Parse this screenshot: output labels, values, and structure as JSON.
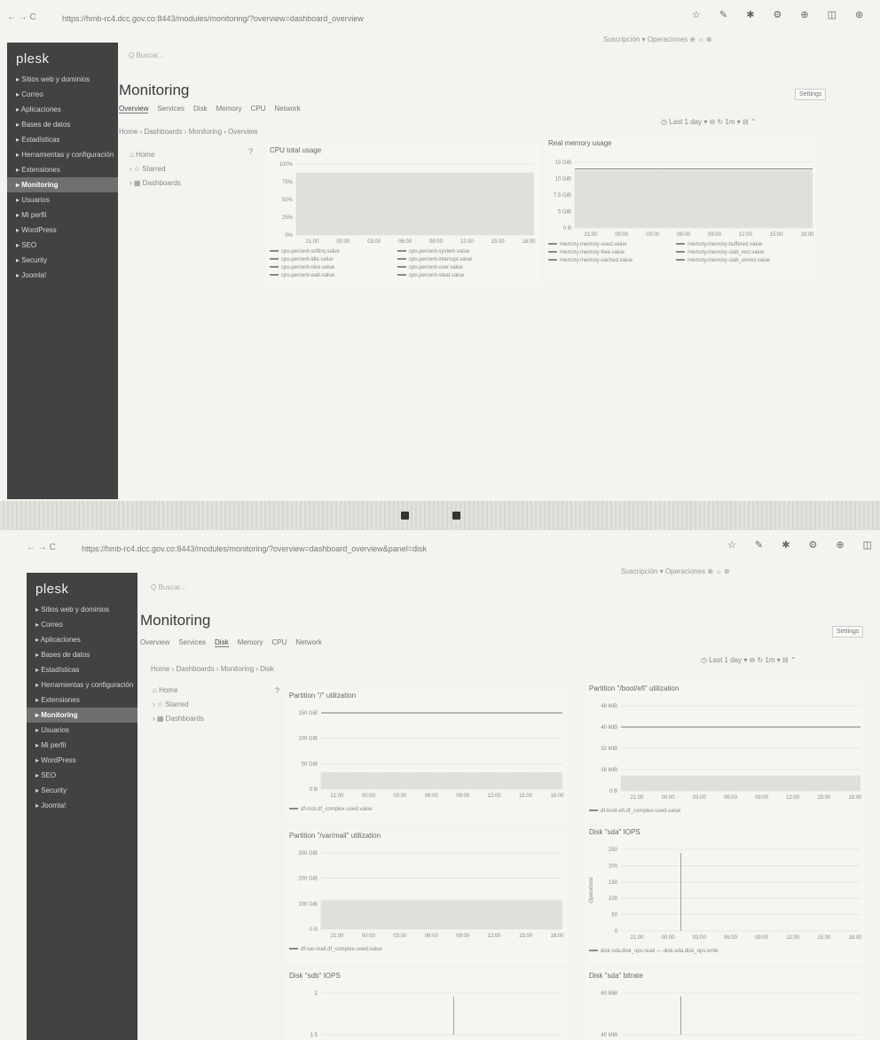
{
  "browser": {
    "nav": "←  →  C",
    "url1": "https://hmb-rc4.dcc.gov.co:8443/modules/monitoring/?overview=dashboard_overview",
    "url2": "https://hmb-rc4.dcc.gov.co:8443/modules/monitoring/?overview=dashboard_overview&panel=disk",
    "toolbar_icons": "☆ ✎ ✱ ⚙ ⊕ ◫  ⊛ ⋮",
    "subbar": "Suscripción ▾   Operaciones   ⊕  ☼  ⊗"
  },
  "sidebar": {
    "logo": "plesk",
    "items": [
      "Sitios web y dominios",
      "Correo",
      "Aplicaciones",
      "Bases de datos",
      "Estadísticas",
      "Herramientas y configuración",
      "Extensiones",
      "Monitoring",
      "Usuarios",
      "Mi perfil",
      "WordPress",
      "SEO",
      "Security",
      "Joomla!"
    ],
    "active_index": 7
  },
  "search_placeholder": "Q  Buscar...",
  "page": {
    "title": "Monitoring",
    "settings": "Settings",
    "tabs": [
      "Overview",
      "Services",
      "Disk",
      "Memory",
      "CPU",
      "Network"
    ],
    "toolbar": "◷ Last 1 day  ▾    ⊖    ↻    1m ▾    ⊟    ⌃"
  },
  "shot1": {
    "breadcrumb": "Home  ›  Dashboards  ›  Monitoring  ›  Overview",
    "tree": [
      "Home",
      "Starred",
      "Dashboards"
    ],
    "cpu_panel": {
      "title": "CPU total usage",
      "yticks": [
        "100%",
        "75%",
        "50%",
        "25%",
        "0%"
      ],
      "xticks": [
        "21:00",
        "00:00",
        "03:00",
        "06:00",
        "09:00",
        "12:00",
        "15:00",
        "18:00"
      ],
      "legend": [
        "cpu.percent-softirq.value",
        "cpu.percent-system.value",
        "cpu.percent-idle.value",
        "cpu.percent-interrupt.value",
        "cpu.percent-nice.value",
        "cpu.percent-user.value",
        "cpu.percent-wait.value",
        "cpu.percent-steal.value"
      ]
    },
    "mem_panel": {
      "title": "Real memory usage",
      "yticks": [
        "15 GiB",
        "10 GiB",
        "7.5 GiB",
        "5 GiB",
        "0 B"
      ],
      "xticks": [
        "21:00",
        "00:00",
        "03:00",
        "06:00",
        "09:00",
        "12:00",
        "15:00",
        "18:00"
      ],
      "legend": [
        "memory.memory-used.value",
        "memory.memory-buffered.value",
        "memory.memory-free.value",
        "memory.memory-slab_recl.value",
        "memory.memory-cached.value",
        "memory.memory-slab_unrecl.value"
      ]
    }
  },
  "shot2": {
    "breadcrumb": "Home  ›  Dashboards  ›  Monitoring  ›  Disk",
    "tree": [
      "Home",
      "Starred",
      "Dashboards"
    ],
    "panels": [
      {
        "title": "Partition \"/\" utilization",
        "yticks": [
          "150 GiB",
          "100 GiB",
          "50 GiB",
          "0 B"
        ],
        "legend": "df-root.df_complex-used.value"
      },
      {
        "title": "Partition \"/boot/efi\" utilization",
        "yticks": [
          "48 MiB",
          "40 MiB",
          "32 MiB",
          "16 MiB",
          "0 B"
        ],
        "legend": "df-boot-efi.df_complex-used.value"
      },
      {
        "title": "Partition \"/var/mail\" utilization",
        "yticks": [
          "300 GiB",
          "200 GiB",
          "100 GiB",
          "0 B"
        ],
        "legend": "df-var-mail.df_complex-used.value"
      },
      {
        "title": "Disk \"sda\" IOPS",
        "yticks": [
          "250",
          "200",
          "150",
          "100",
          "50",
          "0"
        ],
        "ylabel": "Operations",
        "legend": "disk-sda.disk_ops.read  —  disk-sda.disk_ops.write"
      },
      {
        "title": "Disk \"sdb\" IOPS",
        "yticks": [
          "2",
          "1.5"
        ],
        "legend": ""
      },
      {
        "title": "Disk \"sda\" bitrate",
        "yticks": [
          "60 MiB",
          "40 MiB"
        ],
        "legend": ""
      }
    ],
    "xticks": [
      "21:00",
      "00:00",
      "03:00",
      "06:00",
      "09:00",
      "12:00",
      "15:00",
      "18:00"
    ]
  },
  "colors": {
    "sidebar": "#424242",
    "active": "#6f6f6f",
    "background": "#f4f3ef",
    "gridline": "#d8d8d4"
  }
}
